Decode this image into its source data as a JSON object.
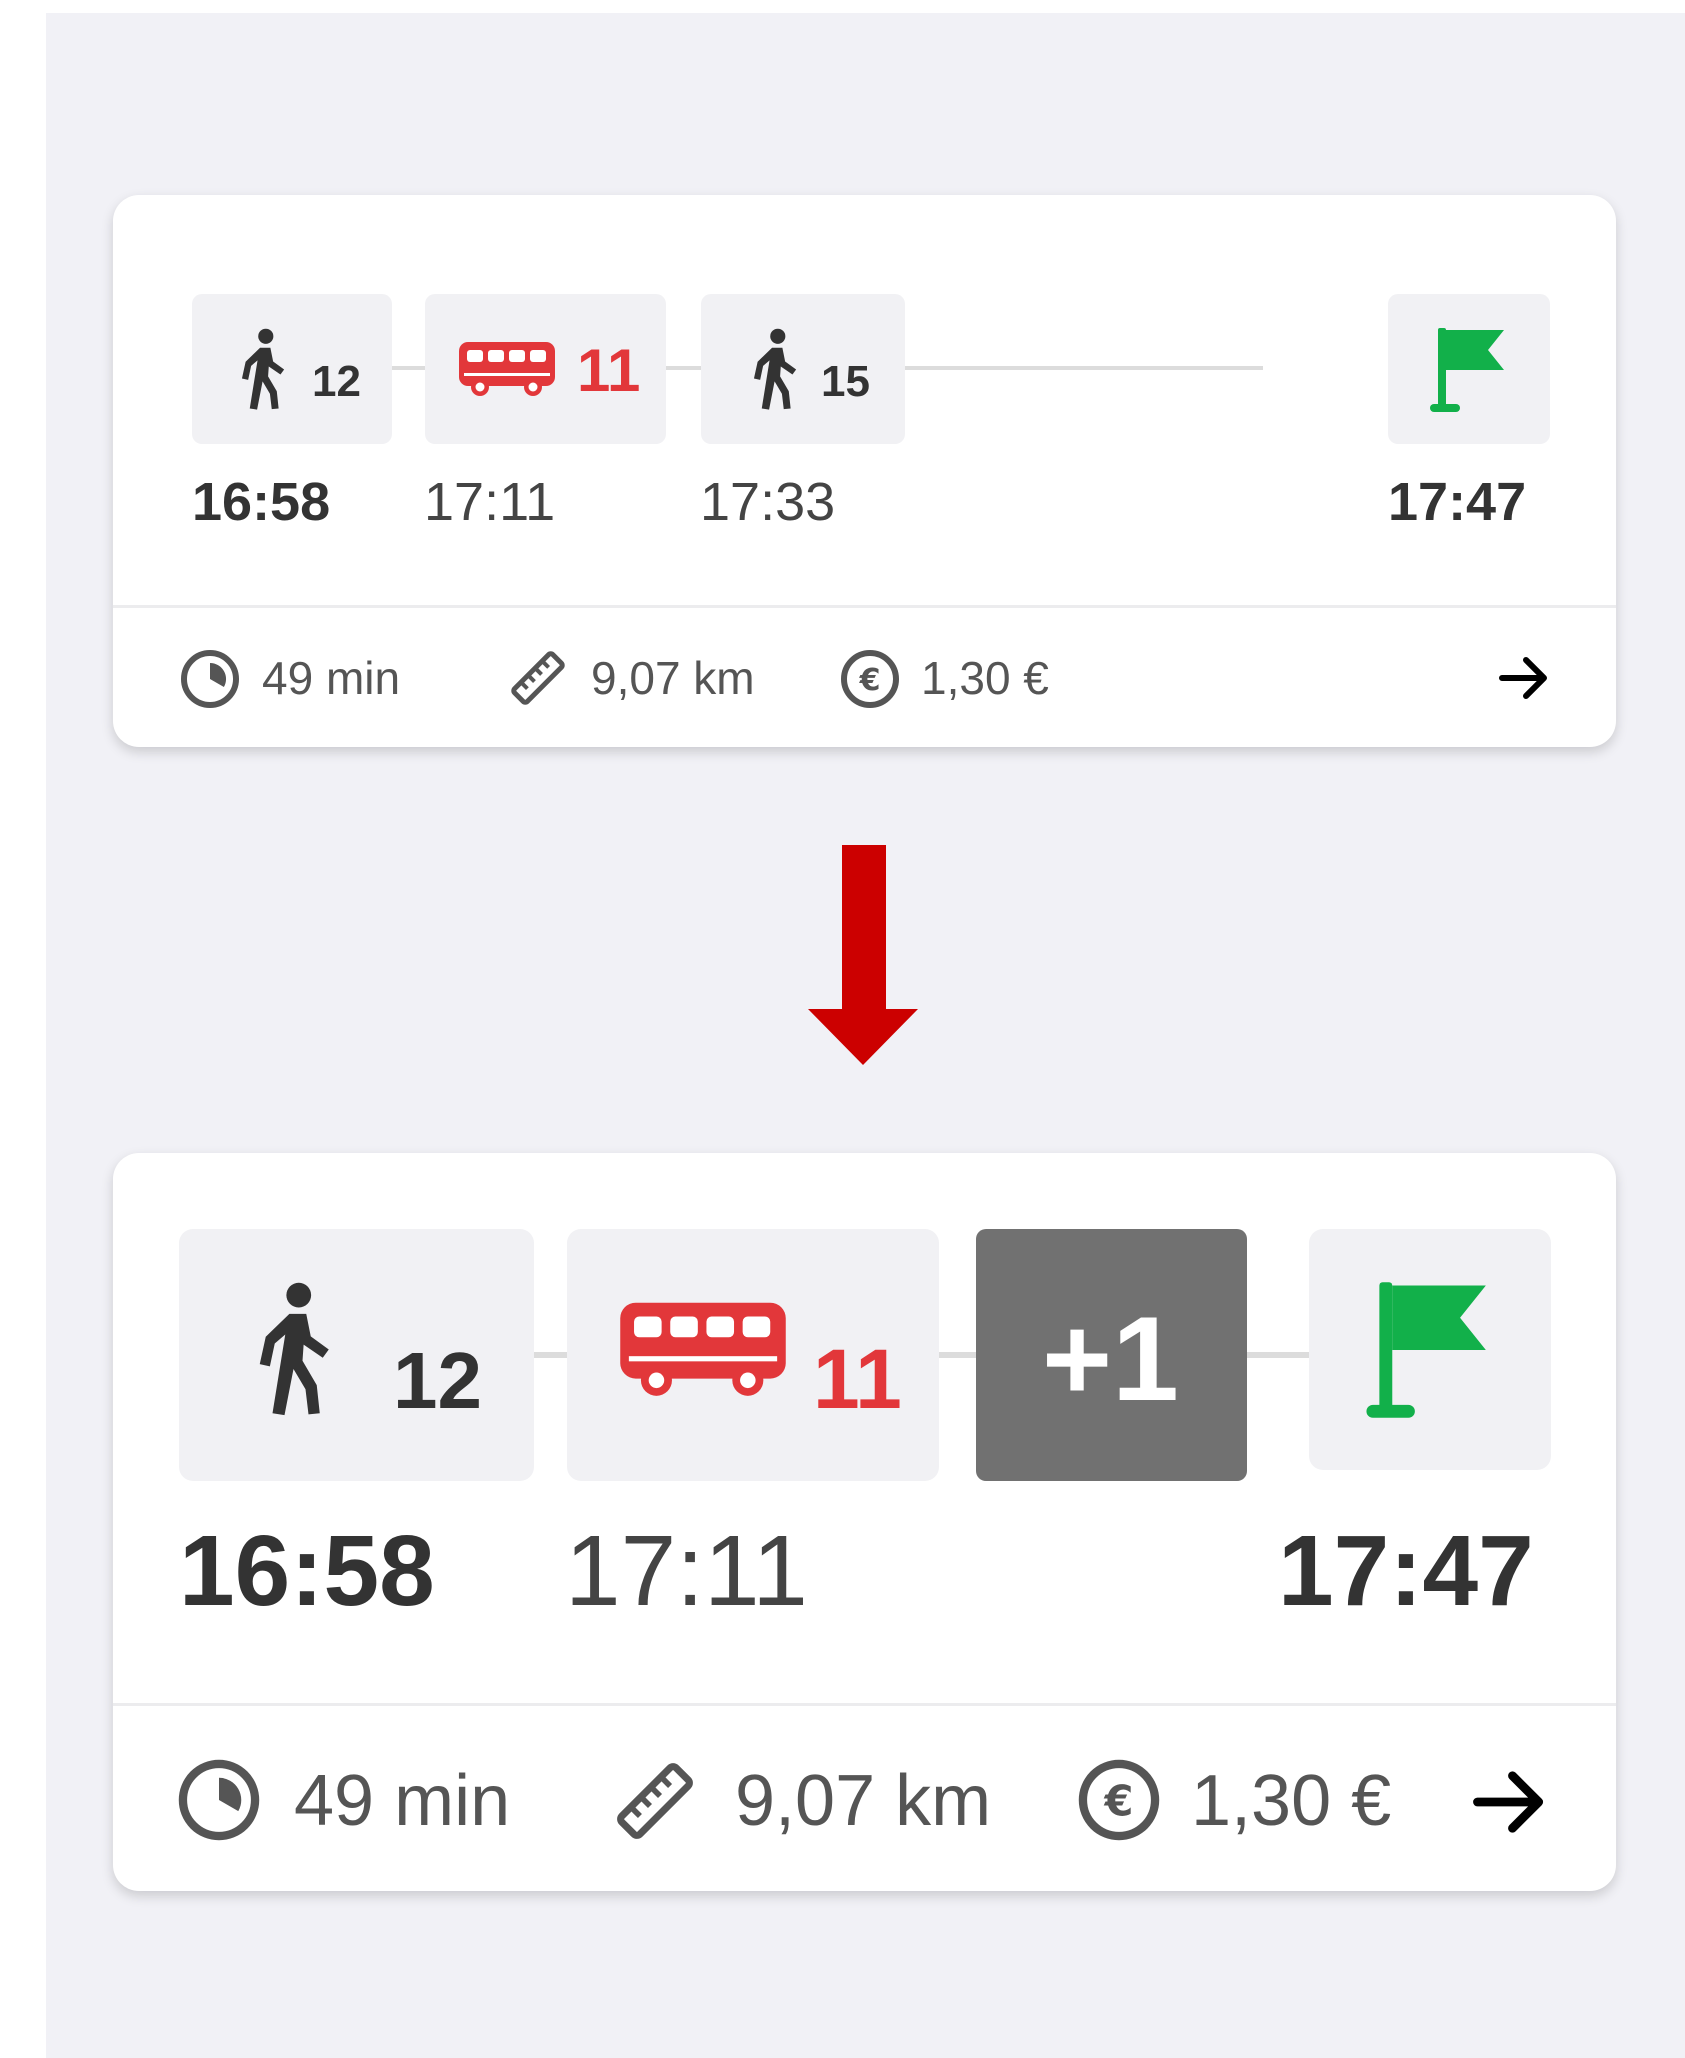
{
  "colors": {
    "background": "#f1f1f6",
    "card": "#ffffff",
    "tile": "#f1f1f4",
    "bus_red": "#e2373a",
    "flag_green": "#12b04a",
    "more_tile": "#717171",
    "arrow_red": "#cc0000"
  },
  "card_before": {
    "legs": [
      {
        "icon": "walk-icon",
        "value": "12"
      },
      {
        "icon": "bus-icon",
        "value": "11"
      },
      {
        "icon": "walk-icon",
        "value": "15"
      },
      {
        "icon": "flag-icon",
        "value": ""
      }
    ],
    "times": [
      "16:58",
      "17:11",
      "17:33",
      "17:47"
    ],
    "footer": {
      "duration": "49 min",
      "distance": "9,07 km",
      "price": "1,30 €"
    }
  },
  "card_after": {
    "legs": [
      {
        "icon": "walk-icon",
        "value": "12"
      },
      {
        "icon": "bus-icon",
        "value": "11"
      },
      {
        "icon": "more-legs",
        "value": "+1"
      },
      {
        "icon": "flag-icon",
        "value": ""
      }
    ],
    "times": [
      "16:58",
      "17:11",
      "17:47"
    ],
    "footer": {
      "duration": "49 min",
      "distance": "9,07 km",
      "price": "1,30 €"
    }
  }
}
